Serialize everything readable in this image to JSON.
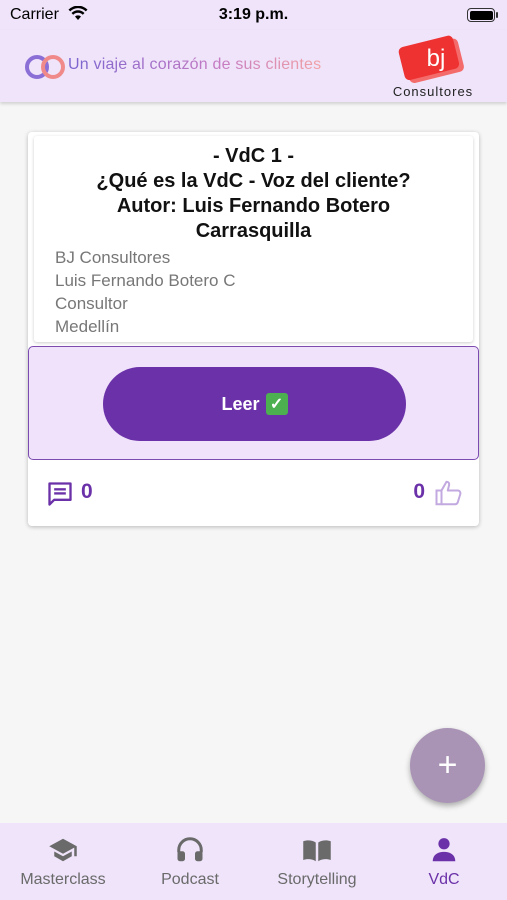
{
  "status_bar": {
    "carrier": "Carrier",
    "time": "3:19 p.m."
  },
  "header": {
    "tagline": "Un viaje al corazón de sus clientes",
    "logo_text": "Consultores"
  },
  "card": {
    "title_lines": [
      "- VdC 1 -",
      "¿Qué es la VdC - Voz del cliente?",
      "Autor: Luis Fernando Botero",
      "Carrasquilla"
    ],
    "details": [
      "BJ Consultores",
      "Luis Fernando Botero C",
      "Consultor",
      "Medellín"
    ],
    "read_button_label": "Leer",
    "comment_count": "0",
    "like_count": "0"
  },
  "fab": {
    "label": "+"
  },
  "nav": {
    "items": [
      {
        "label": "Masterclass",
        "icon": "graduation-cap-icon"
      },
      {
        "label": "Podcast",
        "icon": "headphones-icon"
      },
      {
        "label": "Storytelling",
        "icon": "open-book-icon"
      },
      {
        "label": "VdC",
        "icon": "person-icon",
        "active": true
      }
    ]
  },
  "colors": {
    "accent": "#6b31a8",
    "bar_bg": "#efe4fa",
    "check": "#4caf50"
  }
}
